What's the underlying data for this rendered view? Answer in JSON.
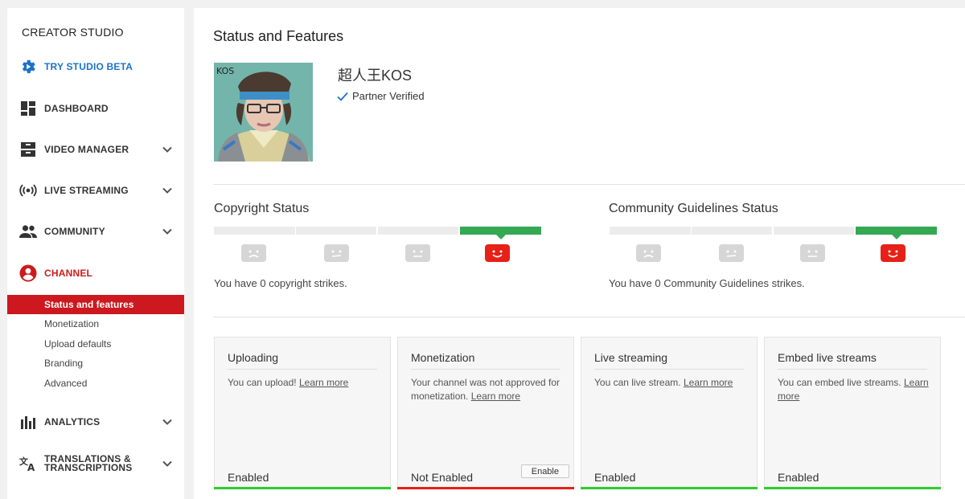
{
  "sidebar": {
    "title": "CREATOR STUDIO",
    "items": [
      {
        "label": "TRY STUDIO BETA",
        "icon": "gear-play-icon"
      },
      {
        "label": "DASHBOARD",
        "icon": "dashboard-icon"
      },
      {
        "label": "VIDEO MANAGER",
        "icon": "video-manager-icon"
      },
      {
        "label": "LIVE STREAMING",
        "icon": "live-icon"
      },
      {
        "label": "COMMUNITY",
        "icon": "people-icon"
      },
      {
        "label": "CHANNEL",
        "icon": "account-icon"
      },
      {
        "label": "ANALYTICS",
        "icon": "bar-chart-icon"
      },
      {
        "label_line1": "TRANSLATIONS &",
        "label_line2": "TRANSCRIPTIONS",
        "icon": "translate-icon"
      }
    ],
    "channel_sub": [
      "Status and features",
      "Monetization",
      "Upload defaults",
      "Branding",
      "Advanced"
    ]
  },
  "main": {
    "title": "Status and Features",
    "channel_name": "超人王KOS",
    "partner_status": "Partner Verified",
    "copyright": {
      "title": "Copyright Status",
      "text": "You have 0 copyright strikes.",
      "level_index": 3
    },
    "community": {
      "title": "Community Guidelines Status",
      "text": "You have 0 Community Guidelines strikes.",
      "level_index": 3
    },
    "cards": [
      {
        "title": "Uploading",
        "desc": "You can upload!",
        "link": "Learn more",
        "state": "Enabled"
      },
      {
        "title": "Monetization",
        "desc": "Your channel was not approved for monetization.",
        "link": "Learn more",
        "state": "Not Enabled",
        "button": "Enable"
      },
      {
        "title": "Live streaming",
        "desc": "You can live stream.",
        "link": "Learn more",
        "state": "Enabled"
      },
      {
        "title": "Embed live streams",
        "desc": "You can embed live streams.",
        "link": "Learn more",
        "state": "Enabled"
      }
    ]
  },
  "colors": {
    "brand_red": "#cc181e",
    "link_blue": "#1a73c9",
    "good_green": "#34a853",
    "enabled_bar": "#2ecc2e",
    "disabled_bar": "#e62117"
  }
}
